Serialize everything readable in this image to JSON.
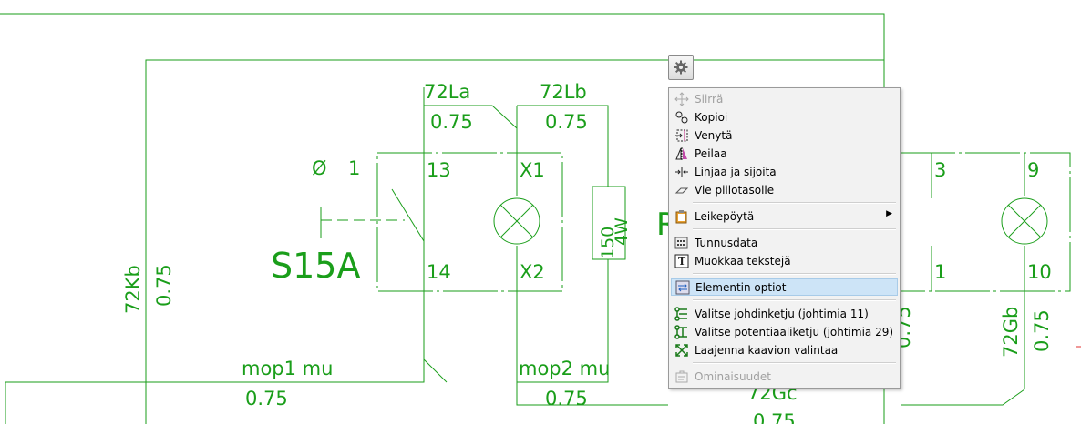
{
  "diagram": {
    "labels": {
      "wire_72La": "72La",
      "wire_72Lb": "72Lb",
      "cs_left1": "0.75",
      "cs_left2": "0.75",
      "switch_symbol": "Ø",
      "switch_one": "1",
      "terminal_13": "13",
      "terminal_14": "14",
      "terminal_x1": "X1",
      "terminal_x2": "X2",
      "switch_name": "S15A",
      "resistor_value": "150",
      "resistor_power": "4W",
      "partial_r": "R",
      "wire_72Kb": "72Kb",
      "cs_72Kb": "0.75",
      "wire_mop1": "mop1 mu",
      "cs_mop1": "0.75",
      "wire_mop2": "mop2 mu",
      "cs_mop2": "0.75",
      "terminal_3": "3",
      "terminal_9": "9",
      "terminal_1": "1",
      "terminal_10": "10",
      "wire_72Gb": "72Gb",
      "cs_72Gb": "0.75",
      "partial_75": "0.75",
      "wire_72Gc": "72Gc",
      "cs_72Gc": "0.75"
    },
    "line_color": "#1a9e1a"
  },
  "settings_button": {
    "icon": "gear-icon"
  },
  "context_menu": {
    "items": [
      {
        "label": "Siirrä",
        "icon": "move-icon",
        "disabled": true
      },
      {
        "label": "Kopioi",
        "icon": "copy-icon"
      },
      {
        "label": "Venytä",
        "icon": "stretch-icon"
      },
      {
        "label": "Peilaa",
        "icon": "mirror-icon"
      },
      {
        "label": "Linjaa ja sijoita",
        "icon": "align-icon"
      },
      {
        "label": "Vie piilotasolle",
        "icon": "hide-layer-icon"
      },
      {
        "label": "Leikepöytä",
        "icon": "clipboard-icon",
        "submenu": true
      },
      {
        "label": "Tunnusdata",
        "icon": "identifier-data-icon"
      },
      {
        "label": "Muokkaa tekstejä",
        "icon": "edit-text-icon"
      },
      {
        "label": "Elementin optiot",
        "icon": "element-options-icon",
        "highlighted": true
      },
      {
        "label": "Valitse johdinketju (johtimia 11)",
        "icon": "wire-chain-icon"
      },
      {
        "label": "Valitse potentiaaliketju (johtimia 29)",
        "icon": "potential-chain-icon"
      },
      {
        "label": "Laajenna kaavion valintaa",
        "icon": "expand-selection-icon"
      },
      {
        "label": "Ominaisuudet",
        "icon": "properties-icon",
        "disabled": true
      }
    ],
    "submenu_arrow": "▶"
  }
}
